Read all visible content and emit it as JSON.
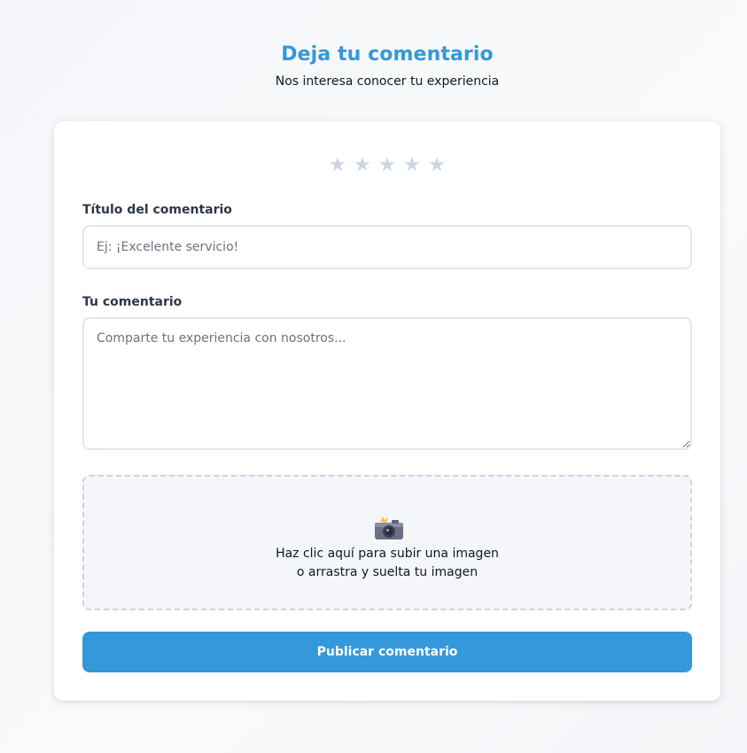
{
  "header": {
    "title": "Deja tu comentario",
    "subtitle": "Nos interesa conocer tu experiencia"
  },
  "rating": {
    "max_stars": 5,
    "selected": 0,
    "star_glyph": "★",
    "empty_color": "#cbd5e1"
  },
  "form": {
    "title_label": "Título del comentario",
    "title_placeholder": "Ej: ¡Excelente servicio!",
    "title_value": "",
    "comment_label": "Tu comentario",
    "comment_placeholder": "Comparte tu experiencia con nosotros...",
    "comment_value": ""
  },
  "upload": {
    "icon": "camera-icon",
    "line1": "Haz clic aquí para subir una imagen",
    "line2": "o arrastra y suelta tu imagen"
  },
  "submit": {
    "label": "Publicar comentario"
  },
  "colors": {
    "accent": "#3498db",
    "input_border": "#e2e8f0",
    "dropzone_bg": "#f4f6fa"
  }
}
